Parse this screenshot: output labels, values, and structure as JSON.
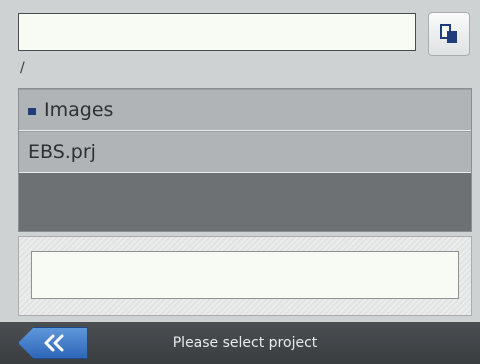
{
  "path_input": {
    "value": ""
  },
  "current_path": "/",
  "files": [
    {
      "name": "Images",
      "type": "folder",
      "icon": "folder-icon"
    },
    {
      "name": "EBS.prj",
      "type": "file"
    }
  ],
  "status_box": {
    "value": ""
  },
  "bottom_bar": {
    "back_icon": "double-chevron-left-icon",
    "status": "Please select project"
  },
  "colors": {
    "accent": "#2e67b8",
    "list_background": "#6d7174",
    "item_background": "#b1b4b6",
    "bar_background": "#3a3d40"
  }
}
